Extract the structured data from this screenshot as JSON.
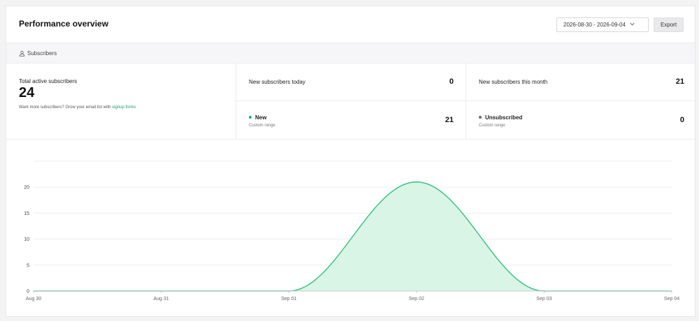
{
  "header": {
    "title": "Performance overview",
    "date_range": "2026-08-30 - 2026-09-04",
    "export_label": "Export"
  },
  "tabs": [
    {
      "label": "Subscribers",
      "icon": "user-icon"
    }
  ],
  "stats": {
    "total": {
      "label": "Total active subscribers",
      "value": "24",
      "note_prefix": "Want more subscribers? Grow your email list with",
      "note_link": "signup forms"
    },
    "today": {
      "label": "New subscribers today",
      "value": "0"
    },
    "month": {
      "label": "New subscribers this month",
      "value": "21"
    },
    "new": {
      "label": "New",
      "sub": "Custom range",
      "value": "21",
      "color": "#12b76a"
    },
    "unsub": {
      "label": "Unsubscribed",
      "sub": "Custom range",
      "value": "0",
      "color": "#6b6b6b"
    }
  },
  "colors": {
    "accent": "#12a061",
    "line": "#2fc27f",
    "fill": "#d9f5e6"
  },
  "chart_data": {
    "type": "area",
    "categories": [
      "Aug 30",
      "Aug 31",
      "Sep 01",
      "Sep 02",
      "Sep 03",
      "Sep 04"
    ],
    "values": [
      0,
      0,
      0,
      21,
      0,
      0
    ],
    "y_ticks": [
      "0",
      "5",
      "10",
      "15",
      "20"
    ],
    "ylim": [
      0,
      25
    ],
    "grid": true
  }
}
